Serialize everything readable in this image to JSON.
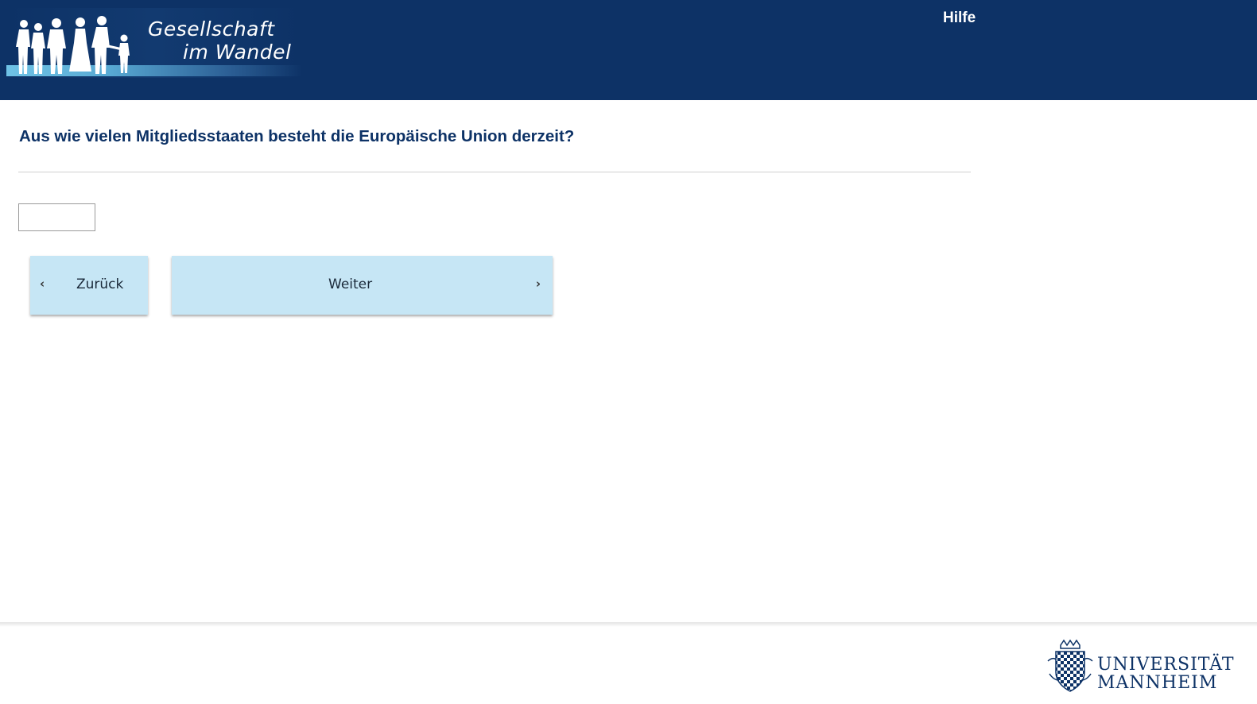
{
  "header": {
    "logo": {
      "line1": "Gesellschaft",
      "line2": "im Wandel"
    },
    "help_link": "Hilfe"
  },
  "question": {
    "text": "Aus wie vielen Mitgliedsstaaten besteht die Europäische Union derzeit?",
    "answer_value": ""
  },
  "navigation": {
    "back_label": "Zurück",
    "next_label": "Weiter"
  },
  "footer": {
    "university_line1": "UNIVERSITÄT",
    "university_line2": "MANNHEIM"
  },
  "icons": {
    "back": "chevron-left-icon",
    "next": "chevron-right-icon",
    "crest": "university-crest-icon"
  },
  "colors": {
    "header_bg": "#0d3266",
    "button_bg": "#c6e6f5",
    "question_text": "#0d3266"
  }
}
